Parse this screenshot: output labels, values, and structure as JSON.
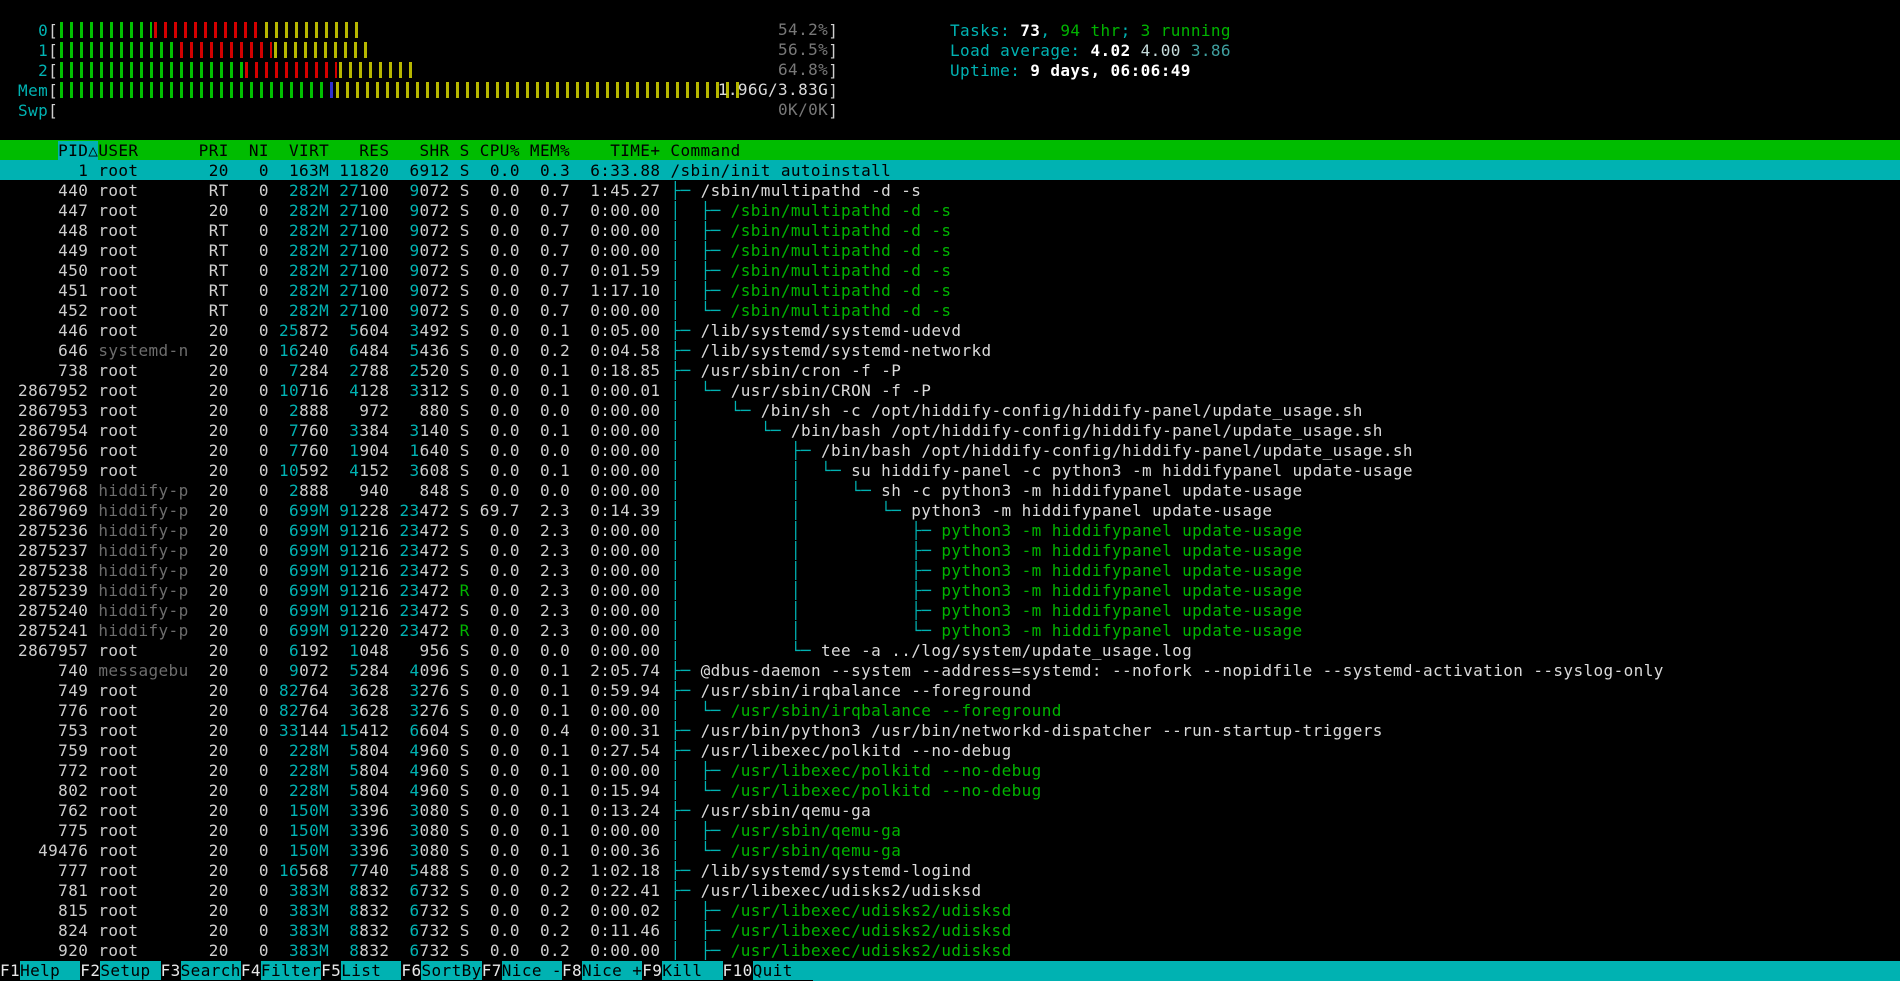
{
  "colors": {
    "background": "#000000",
    "header_bg": "#00bc00",
    "selection_bg": "#00b2b2",
    "cyan_accent": "#00b2b2",
    "thread_green": "#00b400",
    "bar_green": "#00c000",
    "bar_red": "#d40000",
    "bar_yellow": "#b6b600",
    "bar_blue": "#3030d0",
    "shadow_text": "#6d6d6d"
  },
  "meters": {
    "rows": [
      {
        "label": "0",
        "segments": [
          [
            "green",
            12.2
          ],
          [
            "red",
            14.4
          ],
          [
            "yellow",
            12.9
          ]
        ],
        "value": "54.2%",
        "value_class": "c-dim"
      },
      {
        "label": "1",
        "segments": [
          [
            "green",
            15.5
          ],
          [
            "red",
            12.3
          ],
          [
            "yellow",
            12.5
          ]
        ],
        "value": "56.5%",
        "value_class": "c-dim"
      },
      {
        "label": "2",
        "segments": [
          [
            "green",
            24.0
          ],
          [
            "red",
            12.2
          ],
          [
            "yellow",
            9.9
          ]
        ],
        "value": "64.8%",
        "value_class": "c-dim"
      },
      {
        "label": "Mem",
        "segments": [
          [
            "green",
            35.0
          ],
          [
            "blue",
            0.8
          ],
          [
            "yellow",
            53.0
          ]
        ],
        "value": "1.96G/3.83G",
        "value_class": "c-mem"
      },
      {
        "label": "Swp",
        "segments": [],
        "value": "0K/0K",
        "value_class": "c-dim"
      }
    ]
  },
  "summary": {
    "tasks": [
      [
        "Tasks: ",
        "c-cyan"
      ],
      [
        "73",
        "c-white"
      ],
      [
        ", ",
        "c-cyan"
      ],
      [
        "94 thr",
        "c-green"
      ],
      [
        "; ",
        "c-cyan"
      ],
      [
        "3 running",
        "c-green"
      ]
    ],
    "load": [
      [
        "Load average: ",
        "c-cyan"
      ],
      [
        "4.02 ",
        "c-white"
      ],
      [
        "4.00 ",
        "c-load5"
      ],
      [
        "3.86",
        "c-load15"
      ]
    ],
    "uptime": [
      [
        "Uptime: ",
        "c-cyan"
      ],
      [
        "9 days, 06:06:49",
        "c-white"
      ]
    ]
  },
  "table": {
    "sort_indicator": "△",
    "columns": [
      {
        "label": "PID",
        "w": 8,
        "align": "r",
        "sorted": true
      },
      {
        "label": "USER",
        "w": 9,
        "align": "l"
      },
      {
        "label": "PRI",
        "w": 3,
        "align": "r"
      },
      {
        "label": "NI",
        "w": 3,
        "align": "r"
      },
      {
        "label": "VIRT",
        "w": 5,
        "align": "r",
        "memfmt": true
      },
      {
        "label": "RES",
        "w": 5,
        "align": "r",
        "memfmt": true
      },
      {
        "label": "SHR",
        "w": 5,
        "align": "r",
        "memfmt": true
      },
      {
        "label": "S",
        "w": 1,
        "align": "r"
      },
      {
        "label": "CPU%",
        "w": 4,
        "align": "r"
      },
      {
        "label": "MEM%",
        "w": 4,
        "align": "r"
      },
      {
        "label": "TIME+",
        "w": 8,
        "align": "r"
      },
      {
        "label": "Command",
        "w": 0,
        "align": "l"
      }
    ],
    "rows": [
      {
        "pid": "1",
        "user": "root",
        "pri": "20",
        "ni": "0",
        "virt": "163M",
        "res": "11820",
        "shr": "6912",
        "s": "S",
        "cpu": "0.0",
        "mem": "0.3",
        "time": "6:33.88",
        "tree": "",
        "cmd": "/sbin/init autoinstall",
        "selected": true
      },
      {
        "pid": "440",
        "user": "root",
        "pri": "RT",
        "ni": "0",
        "virt": "282M",
        "res": "27100",
        "shr": "9072",
        "s": "S",
        "cpu": "0.0",
        "mem": "0.7",
        "time": "1:45.27",
        "tree": "├─ ",
        "cmd": "/sbin/multipathd -d -s"
      },
      {
        "pid": "447",
        "user": "root",
        "pri": "20",
        "ni": "0",
        "virt": "282M",
        "res": "27100",
        "shr": "9072",
        "s": "S",
        "cpu": "0.0",
        "mem": "0.7",
        "time": "0:00.00",
        "tree": "│  ├─ ",
        "cmd": "/sbin/multipathd -d -s",
        "thread": true
      },
      {
        "pid": "448",
        "user": "root",
        "pri": "RT",
        "ni": "0",
        "virt": "282M",
        "res": "27100",
        "shr": "9072",
        "s": "S",
        "cpu": "0.0",
        "mem": "0.7",
        "time": "0:00.00",
        "tree": "│  ├─ ",
        "cmd": "/sbin/multipathd -d -s",
        "thread": true
      },
      {
        "pid": "449",
        "user": "root",
        "pri": "RT",
        "ni": "0",
        "virt": "282M",
        "res": "27100",
        "shr": "9072",
        "s": "S",
        "cpu": "0.0",
        "mem": "0.7",
        "time": "0:00.00",
        "tree": "│  ├─ ",
        "cmd": "/sbin/multipathd -d -s",
        "thread": true
      },
      {
        "pid": "450",
        "user": "root",
        "pri": "RT",
        "ni": "0",
        "virt": "282M",
        "res": "27100",
        "shr": "9072",
        "s": "S",
        "cpu": "0.0",
        "mem": "0.7",
        "time": "0:01.59",
        "tree": "│  ├─ ",
        "cmd": "/sbin/multipathd -d -s",
        "thread": true
      },
      {
        "pid": "451",
        "user": "root",
        "pri": "RT",
        "ni": "0",
        "virt": "282M",
        "res": "27100",
        "shr": "9072",
        "s": "S",
        "cpu": "0.0",
        "mem": "0.7",
        "time": "1:17.10",
        "tree": "│  ├─ ",
        "cmd": "/sbin/multipathd -d -s",
        "thread": true
      },
      {
        "pid": "452",
        "user": "root",
        "pri": "RT",
        "ni": "0",
        "virt": "282M",
        "res": "27100",
        "shr": "9072",
        "s": "S",
        "cpu": "0.0",
        "mem": "0.7",
        "time": "0:00.00",
        "tree": "│  └─ ",
        "cmd": "/sbin/multipathd -d -s",
        "thread": true
      },
      {
        "pid": "446",
        "user": "root",
        "pri": "20",
        "ni": "0",
        "virt": "25872",
        "res": "5604",
        "shr": "3492",
        "s": "S",
        "cpu": "0.0",
        "mem": "0.1",
        "time": "0:05.00",
        "tree": "├─ ",
        "cmd": "/lib/systemd/systemd-udevd"
      },
      {
        "pid": "646",
        "user": "systemd-n",
        "pri": "20",
        "ni": "0",
        "virt": "16240",
        "res": "6484",
        "shr": "5436",
        "s": "S",
        "cpu": "0.0",
        "mem": "0.2",
        "time": "0:04.58",
        "tree": "├─ ",
        "cmd": "/lib/systemd/systemd-networkd"
      },
      {
        "pid": "738",
        "user": "root",
        "pri": "20",
        "ni": "0",
        "virt": "7284",
        "res": "2788",
        "shr": "2520",
        "s": "S",
        "cpu": "0.0",
        "mem": "0.1",
        "time": "0:18.85",
        "tree": "├─ ",
        "cmd": "/usr/sbin/cron -f -P"
      },
      {
        "pid": "2867952",
        "user": "root",
        "pri": "20",
        "ni": "0",
        "virt": "10716",
        "res": "4128",
        "shr": "3312",
        "s": "S",
        "cpu": "0.0",
        "mem": "0.1",
        "time": "0:00.01",
        "tree": "│  └─ ",
        "cmd": "/usr/sbin/CRON -f -P"
      },
      {
        "pid": "2867953",
        "user": "root",
        "pri": "20",
        "ni": "0",
        "virt": "2888",
        "res": "972",
        "shr": "880",
        "s": "S",
        "cpu": "0.0",
        "mem": "0.0",
        "time": "0:00.00",
        "tree": "│     └─ ",
        "cmd": "/bin/sh -c /opt/hiddify-config/hiddify-panel/update_usage.sh"
      },
      {
        "pid": "2867954",
        "user": "root",
        "pri": "20",
        "ni": "0",
        "virt": "7760",
        "res": "3384",
        "shr": "3140",
        "s": "S",
        "cpu": "0.0",
        "mem": "0.1",
        "time": "0:00.00",
        "tree": "│        └─ ",
        "cmd": "/bin/bash /opt/hiddify-config/hiddify-panel/update_usage.sh"
      },
      {
        "pid": "2867956",
        "user": "root",
        "pri": "20",
        "ni": "0",
        "virt": "7760",
        "res": "1904",
        "shr": "1640",
        "s": "S",
        "cpu": "0.0",
        "mem": "0.0",
        "time": "0:00.00",
        "tree": "│           ├─ ",
        "cmd": "/bin/bash /opt/hiddify-config/hiddify-panel/update_usage.sh"
      },
      {
        "pid": "2867959",
        "user": "root",
        "pri": "20",
        "ni": "0",
        "virt": "10592",
        "res": "4152",
        "shr": "3608",
        "s": "S",
        "cpu": "0.0",
        "mem": "0.1",
        "time": "0:00.00",
        "tree": "│           │  └─ ",
        "cmd": "su hiddify-panel -c python3 -m hiddifypanel update-usage"
      },
      {
        "pid": "2867968",
        "user": "hiddify-p",
        "pri": "20",
        "ni": "0",
        "virt": "2888",
        "res": "940",
        "shr": "848",
        "s": "S",
        "cpu": "0.0",
        "mem": "0.0",
        "time": "0:00.00",
        "tree": "│           │     └─ ",
        "cmd": "sh -c python3 -m hiddifypanel update-usage"
      },
      {
        "pid": "2867969",
        "user": "hiddify-p",
        "pri": "20",
        "ni": "0",
        "virt": "699M",
        "res": "91228",
        "shr": "23472",
        "s": "S",
        "cpu": "69.7",
        "mem": "2.3",
        "time": "0:14.39",
        "tree": "│           │        └─ ",
        "cmd": "python3 -m hiddifypanel update-usage"
      },
      {
        "pid": "2875236",
        "user": "hiddify-p",
        "pri": "20",
        "ni": "0",
        "virt": "699M",
        "res": "91216",
        "shr": "23472",
        "s": "S",
        "cpu": "0.0",
        "mem": "2.3",
        "time": "0:00.00",
        "tree": "│           │           ├─ ",
        "cmd": "python3 -m hiddifypanel update-usage",
        "thread": true
      },
      {
        "pid": "2875237",
        "user": "hiddify-p",
        "pri": "20",
        "ni": "0",
        "virt": "699M",
        "res": "91216",
        "shr": "23472",
        "s": "S",
        "cpu": "0.0",
        "mem": "2.3",
        "time": "0:00.00",
        "tree": "│           │           ├─ ",
        "cmd": "python3 -m hiddifypanel update-usage",
        "thread": true
      },
      {
        "pid": "2875238",
        "user": "hiddify-p",
        "pri": "20",
        "ni": "0",
        "virt": "699M",
        "res": "91216",
        "shr": "23472",
        "s": "S",
        "cpu": "0.0",
        "mem": "2.3",
        "time": "0:00.00",
        "tree": "│           │           ├─ ",
        "cmd": "python3 -m hiddifypanel update-usage",
        "thread": true
      },
      {
        "pid": "2875239",
        "user": "hiddify-p",
        "pri": "20",
        "ni": "0",
        "virt": "699M",
        "res": "91216",
        "shr": "23472",
        "s": "R",
        "cpu": "0.0",
        "mem": "2.3",
        "time": "0:00.00",
        "tree": "│           │           ├─ ",
        "cmd": "python3 -m hiddifypanel update-usage",
        "thread": true,
        "running": true
      },
      {
        "pid": "2875240",
        "user": "hiddify-p",
        "pri": "20",
        "ni": "0",
        "virt": "699M",
        "res": "91216",
        "shr": "23472",
        "s": "S",
        "cpu": "0.0",
        "mem": "2.3",
        "time": "0:00.00",
        "tree": "│           │           ├─ ",
        "cmd": "python3 -m hiddifypanel update-usage",
        "thread": true
      },
      {
        "pid": "2875241",
        "user": "hiddify-p",
        "pri": "20",
        "ni": "0",
        "virt": "699M",
        "res": "91220",
        "shr": "23472",
        "s": "R",
        "cpu": "0.0",
        "mem": "2.3",
        "time": "0:00.00",
        "tree": "│           │           └─ ",
        "cmd": "python3 -m hiddifypanel update-usage",
        "thread": true,
        "running": true
      },
      {
        "pid": "2867957",
        "user": "root",
        "pri": "20",
        "ni": "0",
        "virt": "6192",
        "res": "1048",
        "shr": "956",
        "s": "S",
        "cpu": "0.0",
        "mem": "0.0",
        "time": "0:00.00",
        "tree": "│           └─ ",
        "cmd": "tee -a ../log/system/update_usage.log"
      },
      {
        "pid": "740",
        "user": "messagebu",
        "pri": "20",
        "ni": "0",
        "virt": "9072",
        "res": "5284",
        "shr": "4096",
        "s": "S",
        "cpu": "0.0",
        "mem": "0.1",
        "time": "2:05.74",
        "tree": "├─ ",
        "cmd": "@dbus-daemon --system --address=systemd: --nofork --nopidfile --systemd-activation --syslog-only"
      },
      {
        "pid": "749",
        "user": "root",
        "pri": "20",
        "ni": "0",
        "virt": "82764",
        "res": "3628",
        "shr": "3276",
        "s": "S",
        "cpu": "0.0",
        "mem": "0.1",
        "time": "0:59.94",
        "tree": "├─ ",
        "cmd": "/usr/sbin/irqbalance --foreground"
      },
      {
        "pid": "776",
        "user": "root",
        "pri": "20",
        "ni": "0",
        "virt": "82764",
        "res": "3628",
        "shr": "3276",
        "s": "S",
        "cpu": "0.0",
        "mem": "0.1",
        "time": "0:00.00",
        "tree": "│  └─ ",
        "cmd": "/usr/sbin/irqbalance --foreground",
        "thread": true
      },
      {
        "pid": "753",
        "user": "root",
        "pri": "20",
        "ni": "0",
        "virt": "33144",
        "res": "15412",
        "shr": "6604",
        "s": "S",
        "cpu": "0.0",
        "mem": "0.4",
        "time": "0:00.31",
        "tree": "├─ ",
        "cmd": "/usr/bin/python3 /usr/bin/networkd-dispatcher --run-startup-triggers"
      },
      {
        "pid": "759",
        "user": "root",
        "pri": "20",
        "ni": "0",
        "virt": "228M",
        "res": "5804",
        "shr": "4960",
        "s": "S",
        "cpu": "0.0",
        "mem": "0.1",
        "time": "0:27.54",
        "tree": "├─ ",
        "cmd": "/usr/libexec/polkitd --no-debug"
      },
      {
        "pid": "772",
        "user": "root",
        "pri": "20",
        "ni": "0",
        "virt": "228M",
        "res": "5804",
        "shr": "4960",
        "s": "S",
        "cpu": "0.0",
        "mem": "0.1",
        "time": "0:00.00",
        "tree": "│  ├─ ",
        "cmd": "/usr/libexec/polkitd --no-debug",
        "thread": true
      },
      {
        "pid": "802",
        "user": "root",
        "pri": "20",
        "ni": "0",
        "virt": "228M",
        "res": "5804",
        "shr": "4960",
        "s": "S",
        "cpu": "0.0",
        "mem": "0.1",
        "time": "0:15.94",
        "tree": "│  └─ ",
        "cmd": "/usr/libexec/polkitd --no-debug",
        "thread": true
      },
      {
        "pid": "762",
        "user": "root",
        "pri": "20",
        "ni": "0",
        "virt": "150M",
        "res": "3396",
        "shr": "3080",
        "s": "S",
        "cpu": "0.0",
        "mem": "0.1",
        "time": "0:13.24",
        "tree": "├─ ",
        "cmd": "/usr/sbin/qemu-ga"
      },
      {
        "pid": "775",
        "user": "root",
        "pri": "20",
        "ni": "0",
        "virt": "150M",
        "res": "3396",
        "shr": "3080",
        "s": "S",
        "cpu": "0.0",
        "mem": "0.1",
        "time": "0:00.00",
        "tree": "│  ├─ ",
        "cmd": "/usr/sbin/qemu-ga",
        "thread": true
      },
      {
        "pid": "49476",
        "user": "root",
        "pri": "20",
        "ni": "0",
        "virt": "150M",
        "res": "3396",
        "shr": "3080",
        "s": "S",
        "cpu": "0.0",
        "mem": "0.1",
        "time": "0:00.36",
        "tree": "│  └─ ",
        "cmd": "/usr/sbin/qemu-ga",
        "thread": true
      },
      {
        "pid": "777",
        "user": "root",
        "pri": "20",
        "ni": "0",
        "virt": "16568",
        "res": "7740",
        "shr": "5488",
        "s": "S",
        "cpu": "0.0",
        "mem": "0.2",
        "time": "1:02.18",
        "tree": "├─ ",
        "cmd": "/lib/systemd/systemd-logind"
      },
      {
        "pid": "781",
        "user": "root",
        "pri": "20",
        "ni": "0",
        "virt": "383M",
        "res": "8832",
        "shr": "6732",
        "s": "S",
        "cpu": "0.0",
        "mem": "0.2",
        "time": "0:22.41",
        "tree": "├─ ",
        "cmd": "/usr/libexec/udisks2/udisksd"
      },
      {
        "pid": "815",
        "user": "root",
        "pri": "20",
        "ni": "0",
        "virt": "383M",
        "res": "8832",
        "shr": "6732",
        "s": "S",
        "cpu": "0.0",
        "mem": "0.2",
        "time": "0:00.02",
        "tree": "│  ├─ ",
        "cmd": "/usr/libexec/udisks2/udisksd",
        "thread": true
      },
      {
        "pid": "824",
        "user": "root",
        "pri": "20",
        "ni": "0",
        "virt": "383M",
        "res": "8832",
        "shr": "6732",
        "s": "S",
        "cpu": "0.0",
        "mem": "0.2",
        "time": "0:11.46",
        "tree": "│  ├─ ",
        "cmd": "/usr/libexec/udisks2/udisksd",
        "thread": true
      },
      {
        "pid": "920",
        "user": "root",
        "pri": "20",
        "ni": "0",
        "virt": "383M",
        "res": "8832",
        "shr": "6732",
        "s": "S",
        "cpu": "0.0",
        "mem": "0.2",
        "time": "0:00.00",
        "tree": "│  ├─ ",
        "cmd": "/usr/libexec/udisks2/udisksd",
        "thread": true
      }
    ]
  },
  "function_bar": {
    "items": [
      {
        "key": "F1",
        "label": "Help"
      },
      {
        "key": "F2",
        "label": "Setup"
      },
      {
        "key": "F3",
        "label": "Search"
      },
      {
        "key": "F4",
        "label": "Filter"
      },
      {
        "key": "F5",
        "label": "List"
      },
      {
        "key": "F6",
        "label": "SortBy"
      },
      {
        "key": "F7",
        "label": "Nice -"
      },
      {
        "key": "F8",
        "label": "Nice +"
      },
      {
        "key": "F9",
        "label": "Kill"
      },
      {
        "key": "F10",
        "label": "Quit"
      }
    ]
  }
}
